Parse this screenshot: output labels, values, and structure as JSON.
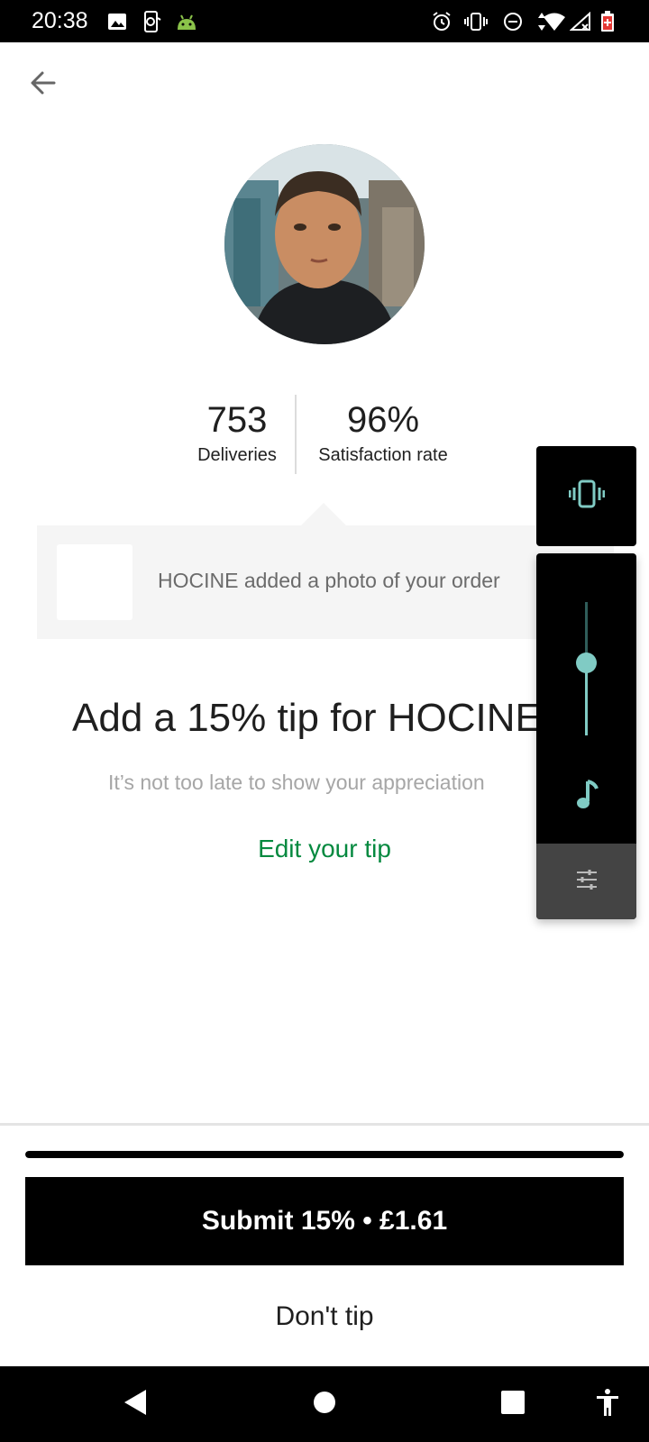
{
  "status_bar": {
    "time": "20:38",
    "left_icons": [
      "image-icon",
      "screen-record-icon",
      "android-icon"
    ],
    "right_icons": [
      "alarm-icon",
      "vibrate-icon",
      "do-not-disturb-icon",
      "wifi-icon",
      "signal-icon",
      "battery-icon"
    ]
  },
  "header": {
    "back_icon": "arrow-left-icon"
  },
  "courier": {
    "deliveries_value": "753",
    "deliveries_label": "Deliveries",
    "satisfaction_value": "96%",
    "satisfaction_label": "Satisfaction rate"
  },
  "photo_card": {
    "text": "HOCINE added a photo of your order"
  },
  "tip": {
    "title": "Add a 15% tip for HOCINE",
    "subtitle": "It’s not too late to show your appreciation",
    "edit_label": "Edit your tip"
  },
  "volume_panel": {
    "vibrate_icon": "vibrate-icon",
    "music_icon": "music-note-icon",
    "settings_icon": "sliders-icon",
    "level": 0.55,
    "accent_color": "#80cbc4"
  },
  "footer": {
    "progress": 1.0,
    "submit_label": "Submit 15% • £1.61",
    "dont_tip_label": "Don't tip"
  },
  "nav_bar": {
    "icons": [
      "back-triangle-icon",
      "home-circle-icon",
      "recents-square-icon",
      "accessibility-icon"
    ]
  },
  "colors": {
    "accent_green": "#05893f",
    "text_dark": "#1f1f1f",
    "text_muted": "#a6a6a6"
  }
}
